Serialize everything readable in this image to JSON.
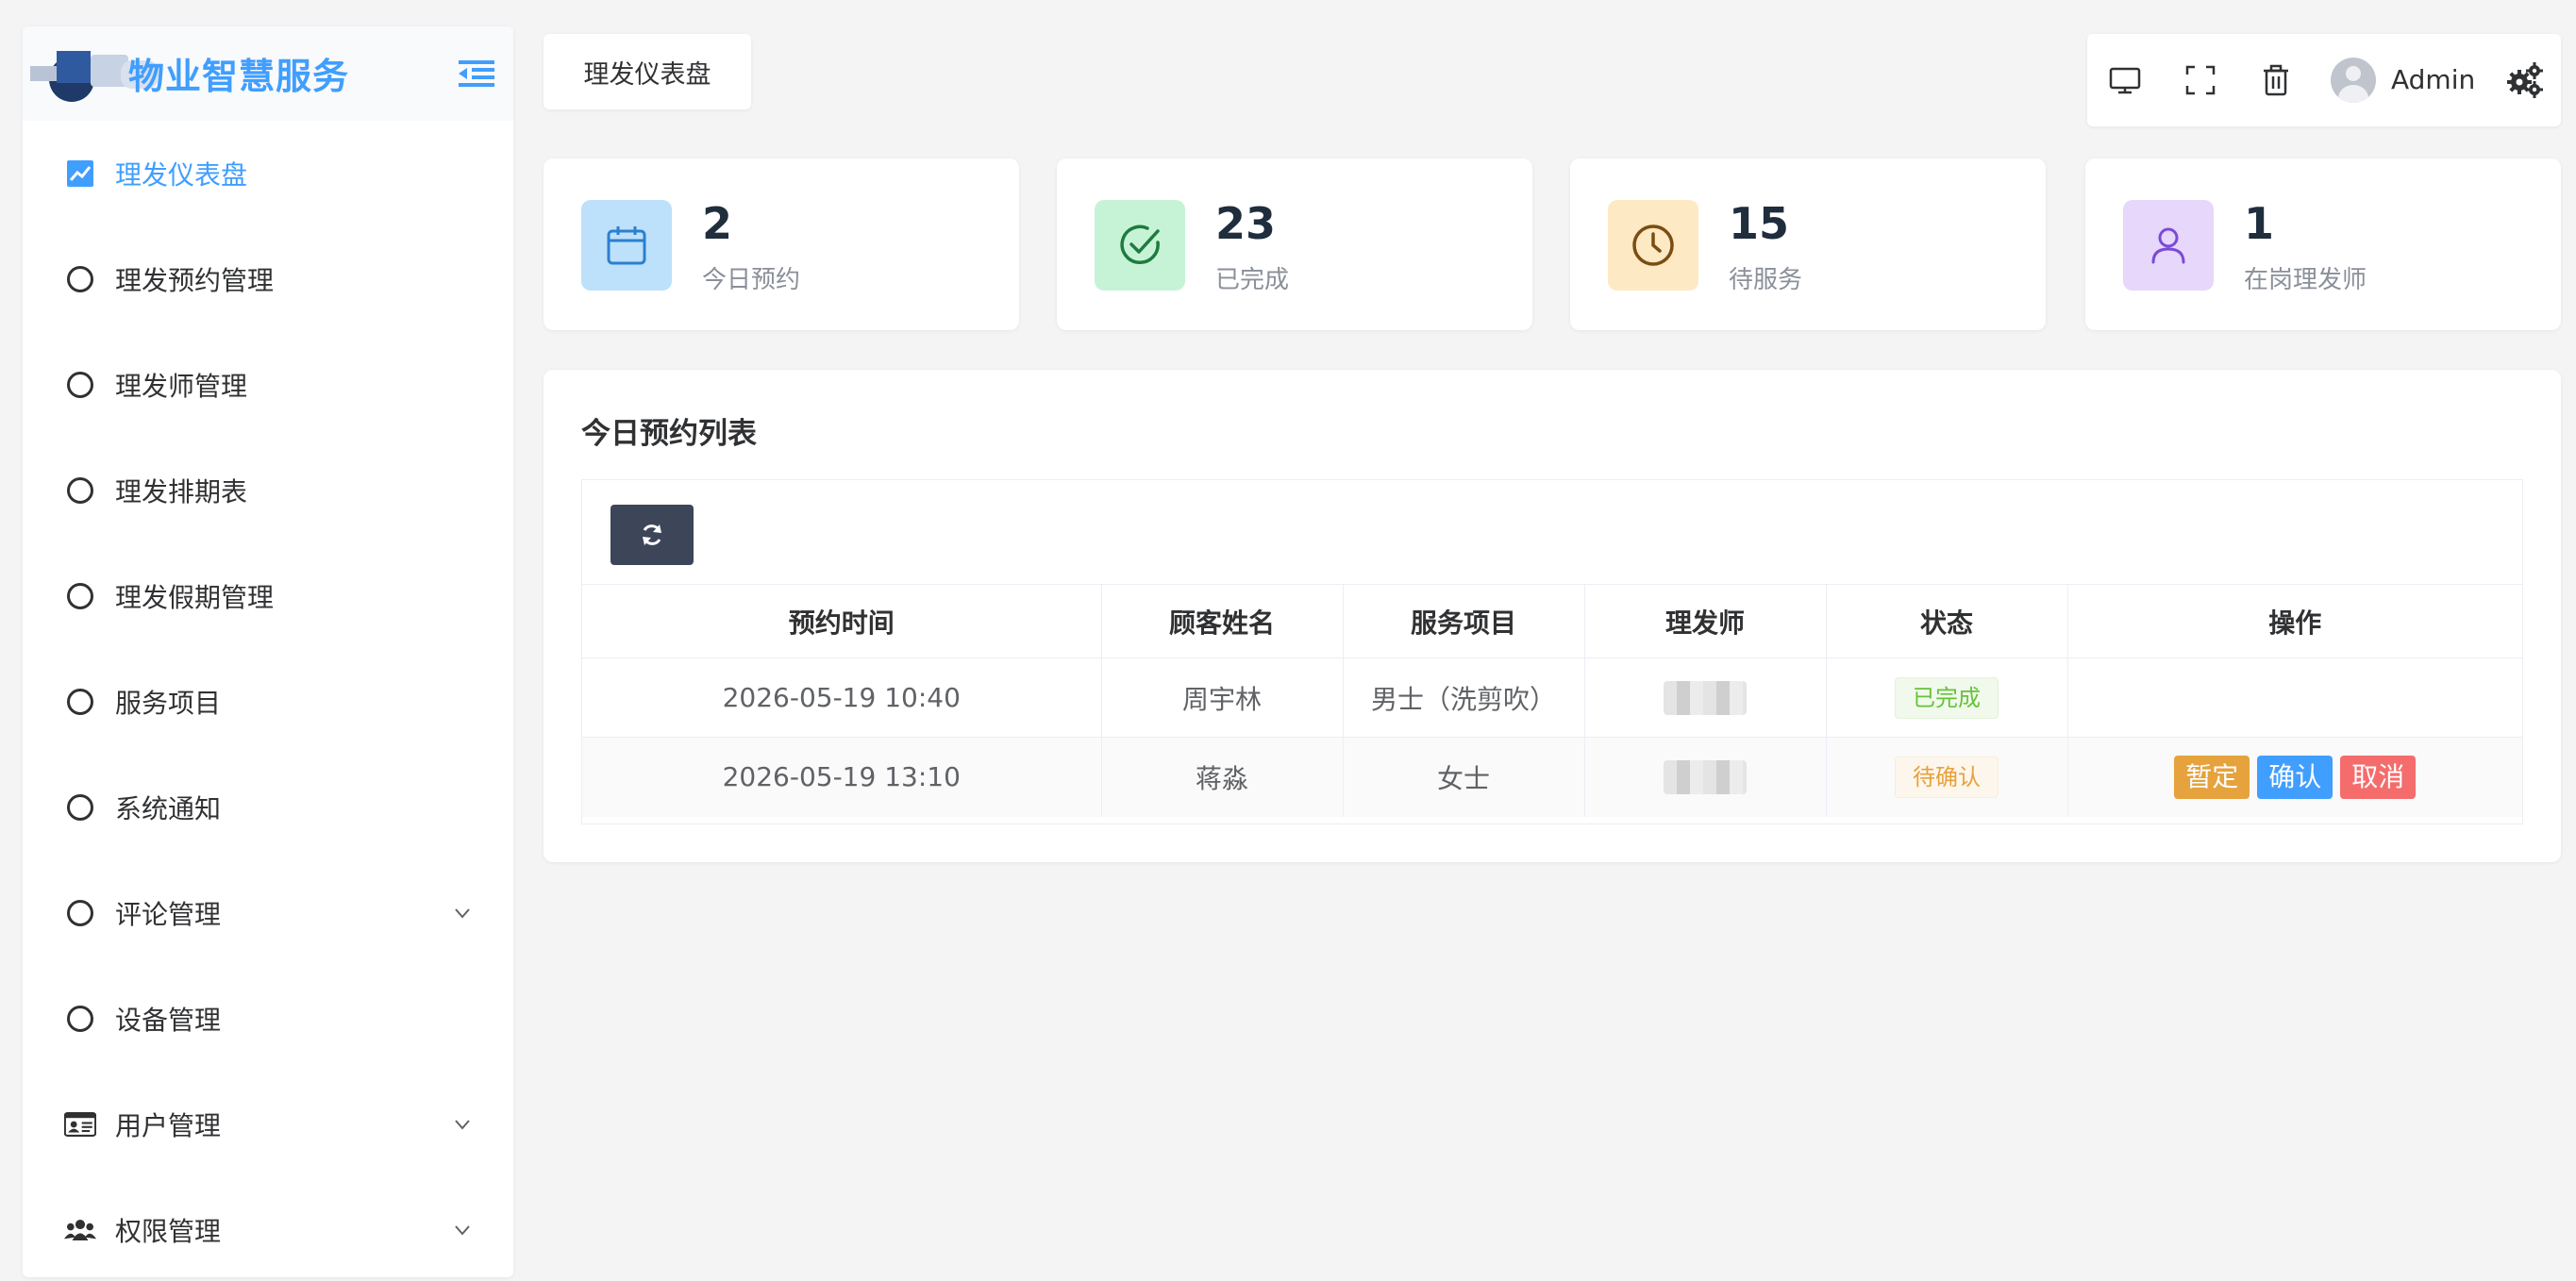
{
  "brand": {
    "title": "物业智慧服务"
  },
  "sidebar": {
    "items": [
      {
        "label": "理发仪表盘",
        "active": true
      },
      {
        "label": "理发预约管理"
      },
      {
        "label": "理发师管理"
      },
      {
        "label": "理发排期表"
      },
      {
        "label": "理发假期管理"
      },
      {
        "label": "服务项目"
      },
      {
        "label": "系统通知"
      },
      {
        "label": "评论管理",
        "expandable": true
      },
      {
        "label": "设备管理"
      },
      {
        "label": "用户管理",
        "expandable": true,
        "icon": "id-card-icon"
      },
      {
        "label": "权限管理",
        "expandable": true,
        "icon": "users-icon"
      }
    ]
  },
  "tabs": {
    "active_label": "理发仪表盘"
  },
  "header": {
    "username": "Admin"
  },
  "stats": [
    {
      "value": "2",
      "label": "今日预约",
      "icon": "calendar-icon",
      "bg": "#bde0fb",
      "color": "#2c7fd0"
    },
    {
      "value": "23",
      "label": "已完成",
      "icon": "check-circle-icon",
      "bg": "#c6f3d6",
      "color": "#1f7a3f"
    },
    {
      "value": "15",
      "label": "待服务",
      "icon": "clock-icon",
      "bg": "#fde9c3",
      "color": "#7a4d12"
    },
    {
      "value": "1",
      "label": "在岗理发师",
      "icon": "user-icon",
      "bg": "#e6d7fb",
      "color": "#7a4bd6"
    }
  ],
  "panel": {
    "title": "今日预约列表",
    "columns": [
      "预约时间",
      "顾客姓名",
      "服务项目",
      "理发师",
      "状态",
      "操作"
    ],
    "rows": [
      {
        "time": "2026-05-19 10:40",
        "customer": "周宇林",
        "service": "男士（洗剪吹）",
        "status": "已完成"
      },
      {
        "time": "2026-05-19 13:10",
        "customer": "蒋淼",
        "service": "女士",
        "status": "待确认",
        "actions": [
          "暂定",
          "确认",
          "取消"
        ]
      }
    ]
  },
  "colors": {
    "accent": "#409eff",
    "success": "#67c23a",
    "warning": "#e6a23c",
    "danger": "#f56c6c"
  }
}
